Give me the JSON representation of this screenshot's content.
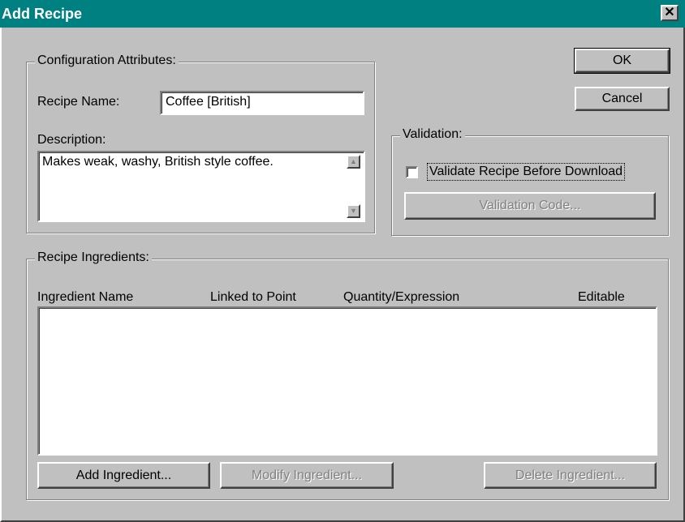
{
  "window": {
    "title": "Add Recipe",
    "close_glyph": "✕"
  },
  "config": {
    "legend": "Configuration Attributes:",
    "recipe_name_label": "Recipe Name:",
    "recipe_name_value": "Coffee [British]",
    "description_label": "Description:",
    "description_value": "Makes weak, washy, British style coffee."
  },
  "buttons": {
    "ok": "OK",
    "cancel": "Cancel"
  },
  "validation": {
    "legend": "Validation:",
    "checkbox_label": "Validate Recipe Before Download",
    "checked": false,
    "code_button": "Validation Code..."
  },
  "ingredients": {
    "legend": "Recipe Ingredients:",
    "columns": [
      "Ingredient Name",
      "Linked to Point",
      "Quantity/Expression",
      "Editable"
    ],
    "rows": [],
    "add_button": "Add Ingredient...",
    "modify_button": "Modify Ingredient...",
    "delete_button": "Delete Ingredient..."
  },
  "icons": {
    "close": "close-icon",
    "scroll_up": "scroll-up-arrow-icon",
    "scroll_down": "scroll-down-arrow-icon"
  }
}
